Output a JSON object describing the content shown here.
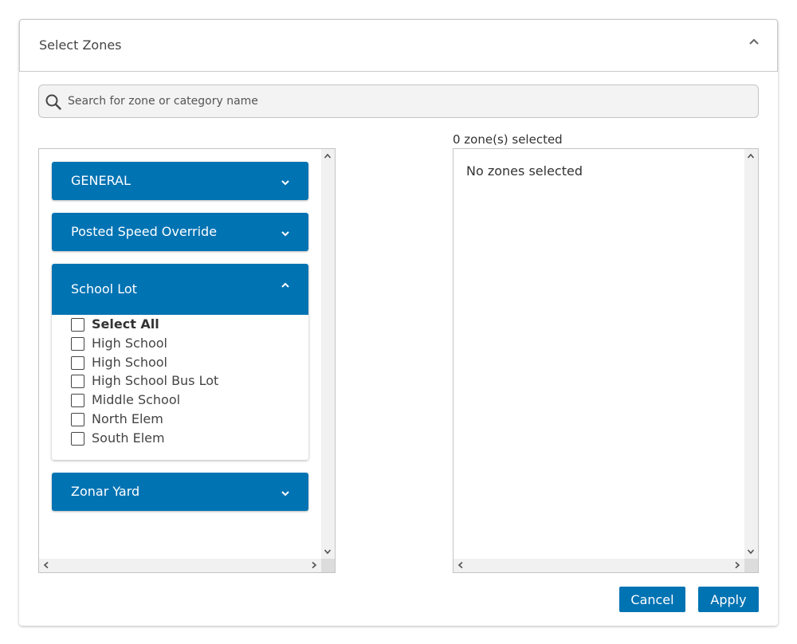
{
  "header": {
    "title": "Select Zones"
  },
  "search": {
    "placeholder": "Search for zone or category name",
    "value": ""
  },
  "categories": [
    {
      "label": "GENERAL",
      "expanded": false
    },
    {
      "label": "Posted Speed Override",
      "expanded": false
    },
    {
      "label": "School Lot",
      "expanded": true,
      "select_all_label": "Select All",
      "items": [
        "High School",
        "High School",
        "High School Bus Lot",
        "Middle School",
        "North Elem",
        "South Elem"
      ]
    },
    {
      "label": "Zonar Yard",
      "expanded": false
    }
  ],
  "selection": {
    "count_label": "0 zone(s) selected",
    "empty_message": "No zones selected"
  },
  "buttons": {
    "cancel": "Cancel",
    "apply": "Apply"
  },
  "colors": {
    "accent": "#0073b3"
  }
}
